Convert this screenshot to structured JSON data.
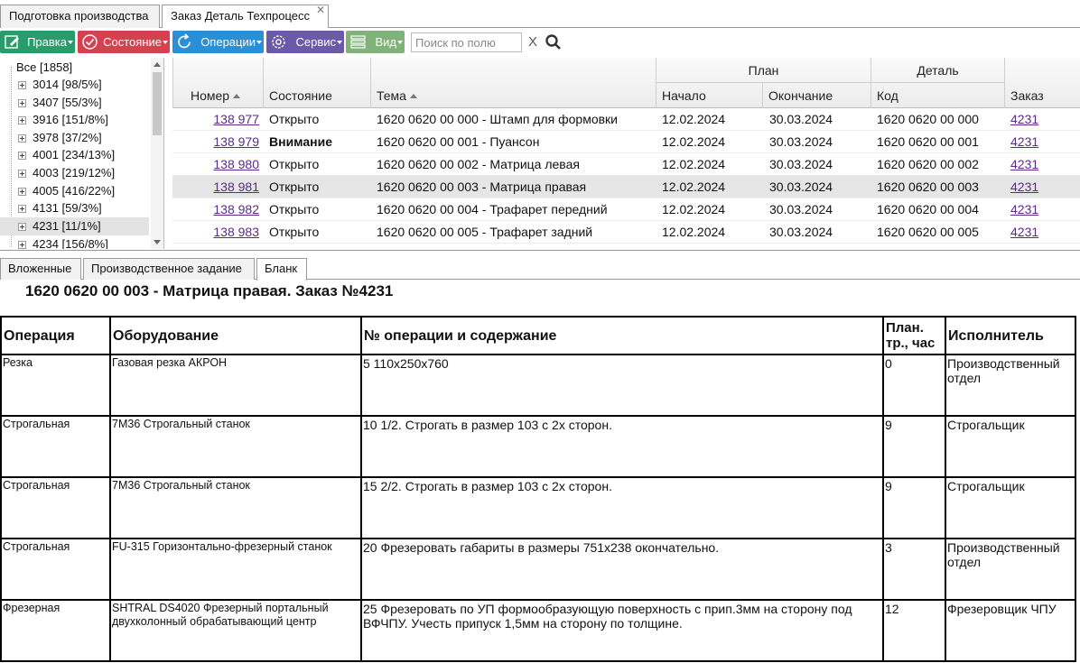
{
  "tabs": [
    {
      "label": "Подготовка производства",
      "active": false
    },
    {
      "label": "Заказ Деталь Техпроцесс",
      "active": true,
      "close": "✕"
    }
  ],
  "toolbar": {
    "buttons": [
      {
        "label": "Правка",
        "color": "#2a9b6a",
        "icon": "edit-icon"
      },
      {
        "label": "Состояние",
        "color": "#d4414f",
        "icon": "check-circle-icon"
      },
      {
        "label": "Операции",
        "color": "#2b8fd6",
        "icon": "refresh-icon"
      },
      {
        "label": "Сервис",
        "color": "#6a5aa8",
        "icon": "gear-icon"
      },
      {
        "label": "Вид",
        "color": "#7fb37a",
        "icon": "list-icon"
      }
    ],
    "search_placeholder": "Поиск по полю",
    "clear": "X"
  },
  "tree": {
    "root": "Все [1858]",
    "items": [
      {
        "label": "3014 [98/5%]"
      },
      {
        "label": "3407 [55/3%]"
      },
      {
        "label": "3916 [151/8%]"
      },
      {
        "label": "3978 [37/2%]"
      },
      {
        "label": "4001 [234/13%]"
      },
      {
        "label": "4003 [219/12%]"
      },
      {
        "label": "4005 [416/22%]"
      },
      {
        "label": "4131 [59/3%]"
      },
      {
        "label": "4231 [11/1%]",
        "selected": true
      },
      {
        "label": "4234 [156/8%]"
      }
    ]
  },
  "grid": {
    "groups": {
      "plan": "План",
      "detail": "Деталь"
    },
    "columns": {
      "number": "Номер",
      "state": "Состояние",
      "theme": "Тема",
      "start": "Начало",
      "end": "Окончание",
      "code": "Код",
      "order": "Заказ"
    },
    "rows": [
      {
        "number": "138 977",
        "state": "Открыто",
        "bold": false,
        "theme": "1620 0620 00 000 - Штамп для формовки",
        "start": "12.02.2024",
        "end": "30.03.2024",
        "code": "1620 0620 00 000",
        "order": "4231"
      },
      {
        "number": "138 979",
        "state": "Внимание",
        "bold": true,
        "theme": "1620 0620 00 001 - Пуансон",
        "start": "12.02.2024",
        "end": "30.03.2024",
        "code": "1620 0620 00 001",
        "order": "4231"
      },
      {
        "number": "138 980",
        "state": "Открыто",
        "bold": false,
        "theme": "1620 0620 00 002 - Матрица левая",
        "start": "12.02.2024",
        "end": "30.03.2024",
        "code": "1620 0620 00 002",
        "order": "4231"
      },
      {
        "number": "138 981",
        "state": "Открыто",
        "bold": false,
        "selected": true,
        "theme": "1620 0620 00 003 - Матрица правая",
        "start": "12.02.2024",
        "end": "30.03.2024",
        "code": "1620 0620 00 003",
        "order": "4231"
      },
      {
        "number": "138 982",
        "state": "Открыто",
        "bold": false,
        "theme": "1620 0620 00 004 - Трафарет передний",
        "start": "12.02.2024",
        "end": "30.03.2024",
        "code": "1620 0620 00 004",
        "order": "4231"
      },
      {
        "number": "138 983",
        "state": "Открыто",
        "bold": false,
        "theme": "1620 0620 00 005 - Трафарет задний",
        "start": "12.02.2024",
        "end": "30.03.2024",
        "code": "1620 0620 00 005",
        "order": "4231"
      }
    ]
  },
  "subtabs": [
    {
      "label": "Вложенные",
      "active": false
    },
    {
      "label": "Производственное задание",
      "active": false
    },
    {
      "label": "Бланк",
      "active": true
    }
  ],
  "blank": {
    "title": "1620 0620 00 003 - Матрица правая. Заказ №4231",
    "headers": {
      "operation": "Операция",
      "equipment": "Оборудование",
      "content": "№ операции и содержание",
      "hours": "План. тр., час",
      "executor": "Исполнитель"
    },
    "rows": [
      {
        "operation": "Резка",
        "equipment": "Газовая резка АКРОН",
        "content": "5 110х250х760",
        "hours": "0",
        "executor": "Производственный отдел"
      },
      {
        "operation": "Строгальная",
        "equipment": "7М36 Строгальный станок",
        "content": "10 1/2. Строгать в размер 103 с 2х сторон.",
        "hours": "9",
        "executor": "Строгальщик"
      },
      {
        "operation": "Строгальная",
        "equipment": "7М36 Строгальный станок",
        "content": "15 2/2. Строгать в размер 103 с 2х сторон.",
        "hours": "9",
        "executor": "Строгальщик"
      },
      {
        "operation": "Строгальная",
        "equipment": "FU-315 Горизонтально-фрезерный станок",
        "content": "20 Фрезеровать габариты в размеры 751х238 окончательно.",
        "hours": "3",
        "executor": "Производственный отдел"
      },
      {
        "operation": "Фрезерная",
        "equipment": "SHTRAL DS4020 Фрезерный портальный двухколонный обрабатывающий центр",
        "content": "25 Фрезеровать по УП формообразующую поверхность с прип.3мм на сторону под ВФЧПУ. Учесть припуск 1,5мм на сторону по толщине.",
        "hours": "12",
        "executor": "Фрезеровщик ЧПУ"
      }
    ]
  }
}
